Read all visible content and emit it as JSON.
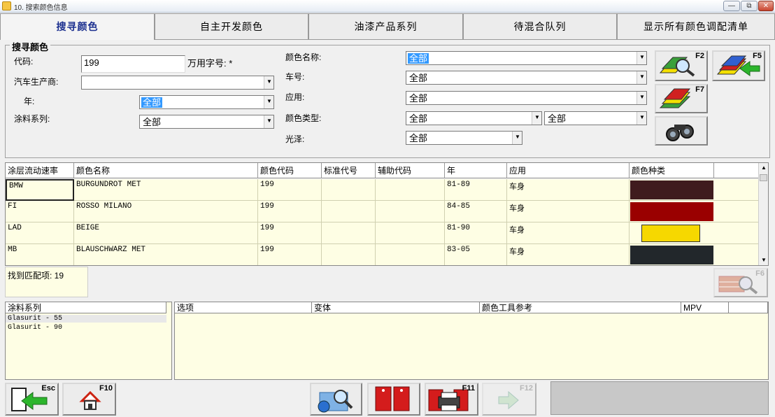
{
  "window": {
    "title": "10. 搜索颜色信息",
    "min_label": "—",
    "max_label": "⧉",
    "close_label": "✕"
  },
  "tabs": [
    {
      "label": "搜寻颜色"
    },
    {
      "label": "自主开发颜色"
    },
    {
      "label": "油漆产品系列"
    },
    {
      "label": "待混合队列"
    },
    {
      "label": "显示所有颜色调配清单"
    }
  ],
  "search": {
    "legend": "搜寻颜色",
    "code_label": "代码:",
    "code_value": "199",
    "wildcard_label": "万用字号: *",
    "maker_label": "汽车生产商:",
    "maker_value": "",
    "year_label": "年:",
    "year_value": "全部",
    "paint_series_label": "涂料系列:",
    "paint_series_value": "全部",
    "color_name_label": "颜色名称:",
    "color_name_value": "全部",
    "model_label": "车号:",
    "model_value": "全部",
    "usage_label": "应用:",
    "usage_value": "全部",
    "color_type_label": "颜色类型:",
    "color_type_value": "全部",
    "color_type_value2": "全部",
    "gloss_label": "光泽:",
    "gloss_value": "全部"
  },
  "fbuttons": {
    "f2": "F2",
    "f5": "F5",
    "f7": "F7",
    "f6": "F6",
    "esc": "Esc",
    "f10": "F10",
    "f11": "F11",
    "f12": "F12"
  },
  "table": {
    "headers": [
      "涂层流动速率",
      "颜色名称",
      "颜色代码",
      "标准代号",
      "辅助代码",
      "年",
      "应用",
      "颜色种类"
    ],
    "rows": [
      {
        "maker": "BMW",
        "name": "BURGUNDROT MET",
        "code": "199",
        "std": "",
        "aux": "",
        "year": "81-89",
        "usage": "车身",
        "swatch": "#3f1b1e"
      },
      {
        "maker": "FI",
        "name": "ROSSO MILANO",
        "code": "199",
        "std": "",
        "aux": "",
        "year": "84-85",
        "usage": "车身",
        "swatch": "#9a0000"
      },
      {
        "maker": "LAD",
        "name": "BEIGE",
        "code": "199",
        "std": "",
        "aux": "",
        "year": "81-90",
        "usage": "车身",
        "swatch": "#f6d800"
      },
      {
        "maker": "MB",
        "name": "BLAUSCHWARZ MET",
        "code": "199",
        "std": "",
        "aux": "",
        "year": "83-05",
        "usage": "车身",
        "swatch": "#22272b"
      }
    ]
  },
  "found": {
    "label": "找到匹配项: 19"
  },
  "series_list": {
    "header": "涂料系列",
    "items": [
      "Glasurit - 55",
      "Glasurit - 90"
    ]
  },
  "detail": {
    "headers": [
      "选项",
      "变体",
      "颜色工具参考",
      "MPV",
      ""
    ]
  },
  "colors": {
    "tab_active_text": "#1b2f8f",
    "row_bg": "#fefee4",
    "select_highlight": "#3399ff"
  }
}
